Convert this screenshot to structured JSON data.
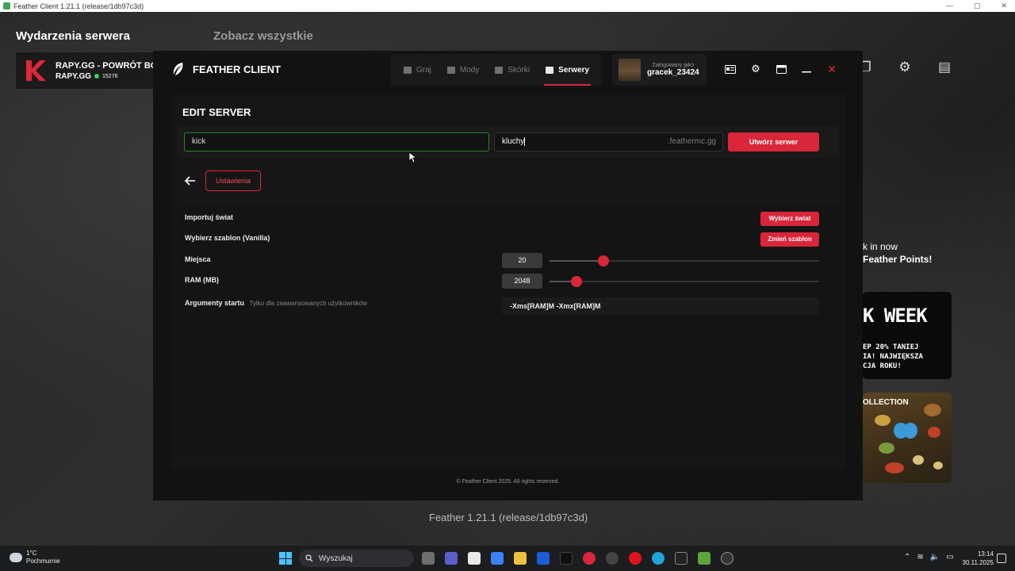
{
  "os_window": {
    "title": "Feather Client 1.21.1 (release/1db97c3d)"
  },
  "background": {
    "heading_events": "Wydarzenia serwera",
    "heading_see_all": "Zobacz wszystkie",
    "server_card": {
      "name": "RAPY.GG - POWRÓT BOX",
      "address": "RAPY.GG",
      "player_count": "15276"
    },
    "promo_text_line1": "k in now",
    "promo_text_line2": "Feather Points!",
    "promo_card_week": {
      "title": "K WEEK",
      "line1": "EP 20% TANIEJ",
      "line2": "IA! NAJWIĘKSZA",
      "line3": "CJA ROKU!"
    },
    "promo_card_collection": {
      "title": "OLLECTION"
    },
    "footer_version": "Feather 1.21.1 (release/1db97c3d)"
  },
  "feather": {
    "logo": "FEATHER CLIENT",
    "nav": [
      {
        "label": "Graj",
        "icon": "gamepad-icon"
      },
      {
        "label": "Mody",
        "icon": "grid-icon"
      },
      {
        "label": "Skórki",
        "icon": "shirt-icon"
      },
      {
        "label": "Serwery",
        "icon": "server-icon",
        "active": true
      }
    ],
    "user": {
      "logged_label": "Zalogowany jako",
      "username": "gracek_23424"
    },
    "footer": "© Feather Client 2025. All rights reserved."
  },
  "edit_server": {
    "title": "EDIT SERVER",
    "name_value": "kick",
    "address_value": "kluchy",
    "address_suffix": ".feathermc.gg",
    "create_button": "Utwórz serwer",
    "tab_settings": "Ustawienia",
    "settings": {
      "import_label": "Importuj świat",
      "import_button": "Wybierz świat",
      "template_label": "Wybierz szablon (Vanilla)",
      "template_button": "Zmień szablon",
      "slots_label": "Miejsca",
      "slots_value": "20",
      "slots_fraction": 0.2,
      "ram_label": "RAM (MB)",
      "ram_value": "2048",
      "ram_fraction": 0.1,
      "args_label": "Argumenty startu",
      "args_hint": "Tylko dla zaawansowanych użytkowników",
      "args_value": "-Xms[RAM]M -Xmx[RAM]M"
    }
  },
  "taskbar": {
    "weather_temp": "1°C",
    "weather_desc": "Pochmurnie",
    "search_placeholder": "Wyszukaj",
    "time": "13:14",
    "date": "30.11.2025"
  },
  "colors": {
    "accent": "#d9263a",
    "input_border_active": "#2e7d32"
  }
}
